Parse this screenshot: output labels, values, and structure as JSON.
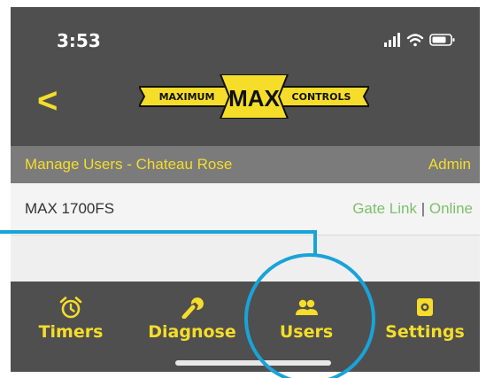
{
  "status_bar": {
    "time": "3:53",
    "icons": [
      "signal-icon",
      "wifi-icon",
      "battery-icon"
    ]
  },
  "nav": {
    "back_glyph": "<",
    "logo": {
      "left_text": "MAXIMUM",
      "center_text": "MAX",
      "right_text": "CONTROLS"
    }
  },
  "header": {
    "title": "Manage Users - Chateau Rose",
    "role": "Admin"
  },
  "device": {
    "name": "MAX 1700FS",
    "link": "Gate Link",
    "separator": "|",
    "status": "Online"
  },
  "tabs": [
    {
      "label": "Timers",
      "icon": "alarm-clock-icon"
    },
    {
      "label": "Diagnose",
      "icon": "wrench-icon"
    },
    {
      "label": "Users",
      "icon": "users-icon"
    },
    {
      "label": "Settings",
      "icon": "gear-icon"
    }
  ],
  "colors": {
    "accent": "#f5dd2a",
    "background": "#4f4f4f",
    "header": "#7b7b7b",
    "online": "#7dbf6d",
    "annotation": "#19a3d9"
  }
}
